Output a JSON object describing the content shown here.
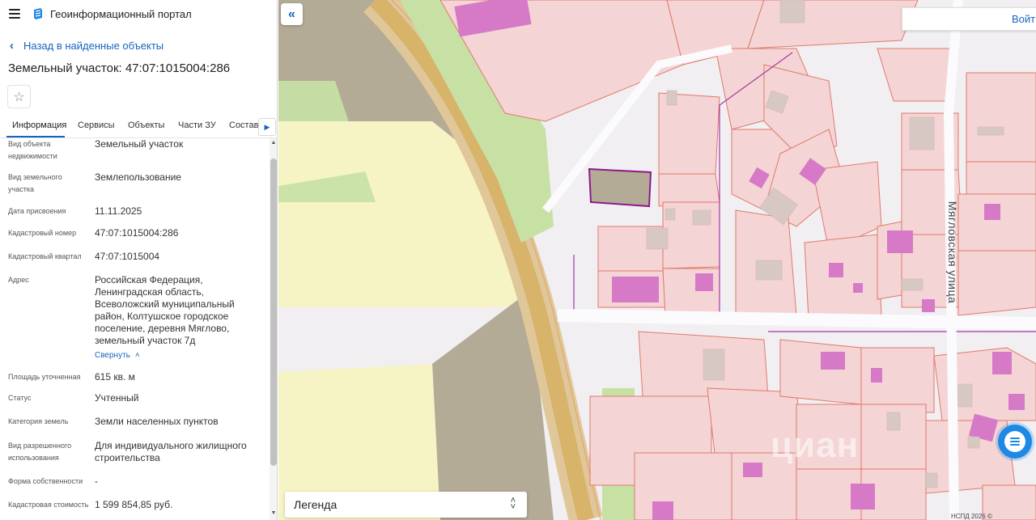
{
  "header": {
    "menu_icon": "hamburger-menu-icon",
    "logo_icon": "portal-logo-icon",
    "title": "Геоинформационный портал"
  },
  "navigation": {
    "back_label": "Назад в найденные объекты"
  },
  "object": {
    "title": "Земельный участок: 47:07:1015004:286",
    "favorite_icon": "star-icon"
  },
  "tabs": [
    {
      "label": "Информация",
      "active": true
    },
    {
      "label": "Сервисы",
      "active": false
    },
    {
      "label": "Объекты",
      "active": false
    },
    {
      "label": "Части ЗУ",
      "active": false
    },
    {
      "label": "Состав",
      "active": false
    }
  ],
  "info": {
    "object_type": {
      "label": "Вид объекта недвижимости",
      "value": "Земельный участок"
    },
    "land_type": {
      "label": "Вид земельного участка",
      "value": "Землепользование"
    },
    "assign_date": {
      "label": "Дата присвоения",
      "value": "11.11.2025"
    },
    "cadastral_number": {
      "label": "Кадастровый номер",
      "value": "47:07:1015004:286"
    },
    "cadastral_quarter": {
      "label": "Кадастровый квартал",
      "value": "47:07:1015004"
    },
    "address": {
      "label": "Адрес",
      "value": "Российская Федерация, Ленинградская область, Всеволожский муниципальный район, Колтушское городское поселение, деревня Мяглово, земельный участок 7д"
    },
    "collapse_label": "Свернуть",
    "area": {
      "label": "Площадь уточненная",
      "value": "615 кв. м"
    },
    "status": {
      "label": "Статус",
      "value": "Учтенный"
    },
    "land_category": {
      "label": "Категория земель",
      "value": "Земли населенных пунктов"
    },
    "permitted_use": {
      "label": "Вид разрешенного использования",
      "value": "Для индивидуального жилищного строительства"
    },
    "ownership": {
      "label": "Форма собственности",
      "value": "-"
    },
    "cadastral_value": {
      "label": "Кадастровая стоимость",
      "value": "1 599 854,85 руб."
    }
  },
  "map": {
    "login_label": "Войти",
    "legend_label": "Легенда",
    "street_label": "Мягловская улица",
    "watermark": "циан",
    "copyright": "НСПД 2026 ©",
    "chat_icon": "chat-icon",
    "colors": {
      "parcel_fill": "#f4d4d4",
      "parcel_border": "#e07a6a",
      "building_fill": "#d67ac8",
      "selected_border": "#8b1a8b",
      "road_fill": "#d8b36a",
      "forest_fill": "#b4ab96",
      "field_fill": "#f6f3c4",
      "green_fill": "#c7e1a5",
      "accent": "#1565c0"
    }
  }
}
